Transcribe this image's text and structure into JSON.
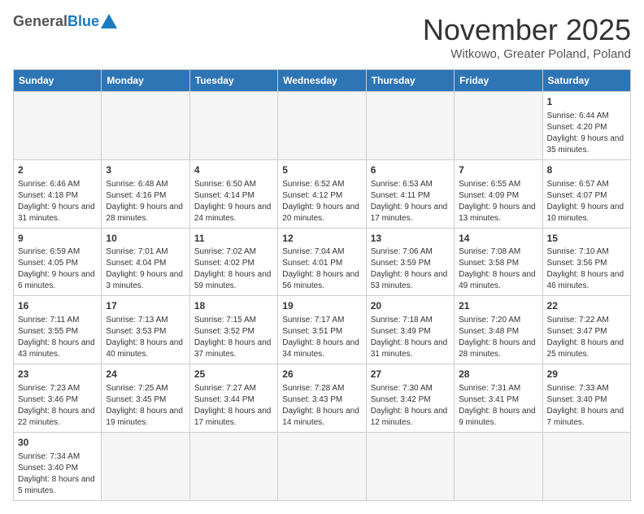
{
  "header": {
    "logo_general": "General",
    "logo_blue": "Blue",
    "month_year": "November 2025",
    "location": "Witkowo, Greater Poland, Poland"
  },
  "days_of_week": [
    "Sunday",
    "Monday",
    "Tuesday",
    "Wednesday",
    "Thursday",
    "Friday",
    "Saturday"
  ],
  "weeks": [
    [
      {
        "day": "",
        "info": ""
      },
      {
        "day": "",
        "info": ""
      },
      {
        "day": "",
        "info": ""
      },
      {
        "day": "",
        "info": ""
      },
      {
        "day": "",
        "info": ""
      },
      {
        "day": "",
        "info": ""
      },
      {
        "day": "1",
        "info": "Sunrise: 6:44 AM\nSunset: 4:20 PM\nDaylight: 9 hours and 35 minutes."
      }
    ],
    [
      {
        "day": "2",
        "info": "Sunrise: 6:46 AM\nSunset: 4:18 PM\nDaylight: 9 hours and 31 minutes."
      },
      {
        "day": "3",
        "info": "Sunrise: 6:48 AM\nSunset: 4:16 PM\nDaylight: 9 hours and 28 minutes."
      },
      {
        "day": "4",
        "info": "Sunrise: 6:50 AM\nSunset: 4:14 PM\nDaylight: 9 hours and 24 minutes."
      },
      {
        "day": "5",
        "info": "Sunrise: 6:52 AM\nSunset: 4:12 PM\nDaylight: 9 hours and 20 minutes."
      },
      {
        "day": "6",
        "info": "Sunrise: 6:53 AM\nSunset: 4:11 PM\nDaylight: 9 hours and 17 minutes."
      },
      {
        "day": "7",
        "info": "Sunrise: 6:55 AM\nSunset: 4:09 PM\nDaylight: 9 hours and 13 minutes."
      },
      {
        "day": "8",
        "info": "Sunrise: 6:57 AM\nSunset: 4:07 PM\nDaylight: 9 hours and 10 minutes."
      }
    ],
    [
      {
        "day": "9",
        "info": "Sunrise: 6:59 AM\nSunset: 4:05 PM\nDaylight: 9 hours and 6 minutes."
      },
      {
        "day": "10",
        "info": "Sunrise: 7:01 AM\nSunset: 4:04 PM\nDaylight: 9 hours and 3 minutes."
      },
      {
        "day": "11",
        "info": "Sunrise: 7:02 AM\nSunset: 4:02 PM\nDaylight: 8 hours and 59 minutes."
      },
      {
        "day": "12",
        "info": "Sunrise: 7:04 AM\nSunset: 4:01 PM\nDaylight: 8 hours and 56 minutes."
      },
      {
        "day": "13",
        "info": "Sunrise: 7:06 AM\nSunset: 3:59 PM\nDaylight: 8 hours and 53 minutes."
      },
      {
        "day": "14",
        "info": "Sunrise: 7:08 AM\nSunset: 3:58 PM\nDaylight: 8 hours and 49 minutes."
      },
      {
        "day": "15",
        "info": "Sunrise: 7:10 AM\nSunset: 3:56 PM\nDaylight: 8 hours and 46 minutes."
      }
    ],
    [
      {
        "day": "16",
        "info": "Sunrise: 7:11 AM\nSunset: 3:55 PM\nDaylight: 8 hours and 43 minutes."
      },
      {
        "day": "17",
        "info": "Sunrise: 7:13 AM\nSunset: 3:53 PM\nDaylight: 8 hours and 40 minutes."
      },
      {
        "day": "18",
        "info": "Sunrise: 7:15 AM\nSunset: 3:52 PM\nDaylight: 8 hours and 37 minutes."
      },
      {
        "day": "19",
        "info": "Sunrise: 7:17 AM\nSunset: 3:51 PM\nDaylight: 8 hours and 34 minutes."
      },
      {
        "day": "20",
        "info": "Sunrise: 7:18 AM\nSunset: 3:49 PM\nDaylight: 8 hours and 31 minutes."
      },
      {
        "day": "21",
        "info": "Sunrise: 7:20 AM\nSunset: 3:48 PM\nDaylight: 8 hours and 28 minutes."
      },
      {
        "day": "22",
        "info": "Sunrise: 7:22 AM\nSunset: 3:47 PM\nDaylight: 8 hours and 25 minutes."
      }
    ],
    [
      {
        "day": "23",
        "info": "Sunrise: 7:23 AM\nSunset: 3:46 PM\nDaylight: 8 hours and 22 minutes."
      },
      {
        "day": "24",
        "info": "Sunrise: 7:25 AM\nSunset: 3:45 PM\nDaylight: 8 hours and 19 minutes."
      },
      {
        "day": "25",
        "info": "Sunrise: 7:27 AM\nSunset: 3:44 PM\nDaylight: 8 hours and 17 minutes."
      },
      {
        "day": "26",
        "info": "Sunrise: 7:28 AM\nSunset: 3:43 PM\nDaylight: 8 hours and 14 minutes."
      },
      {
        "day": "27",
        "info": "Sunrise: 7:30 AM\nSunset: 3:42 PM\nDaylight: 8 hours and 12 minutes."
      },
      {
        "day": "28",
        "info": "Sunrise: 7:31 AM\nSunset: 3:41 PM\nDaylight: 8 hours and 9 minutes."
      },
      {
        "day": "29",
        "info": "Sunrise: 7:33 AM\nSunset: 3:40 PM\nDaylight: 8 hours and 7 minutes."
      }
    ],
    [
      {
        "day": "30",
        "info": "Sunrise: 7:34 AM\nSunset: 3:40 PM\nDaylight: 8 hours and 5 minutes."
      },
      {
        "day": "",
        "info": ""
      },
      {
        "day": "",
        "info": ""
      },
      {
        "day": "",
        "info": ""
      },
      {
        "day": "",
        "info": ""
      },
      {
        "day": "",
        "info": ""
      },
      {
        "day": "",
        "info": ""
      }
    ]
  ]
}
